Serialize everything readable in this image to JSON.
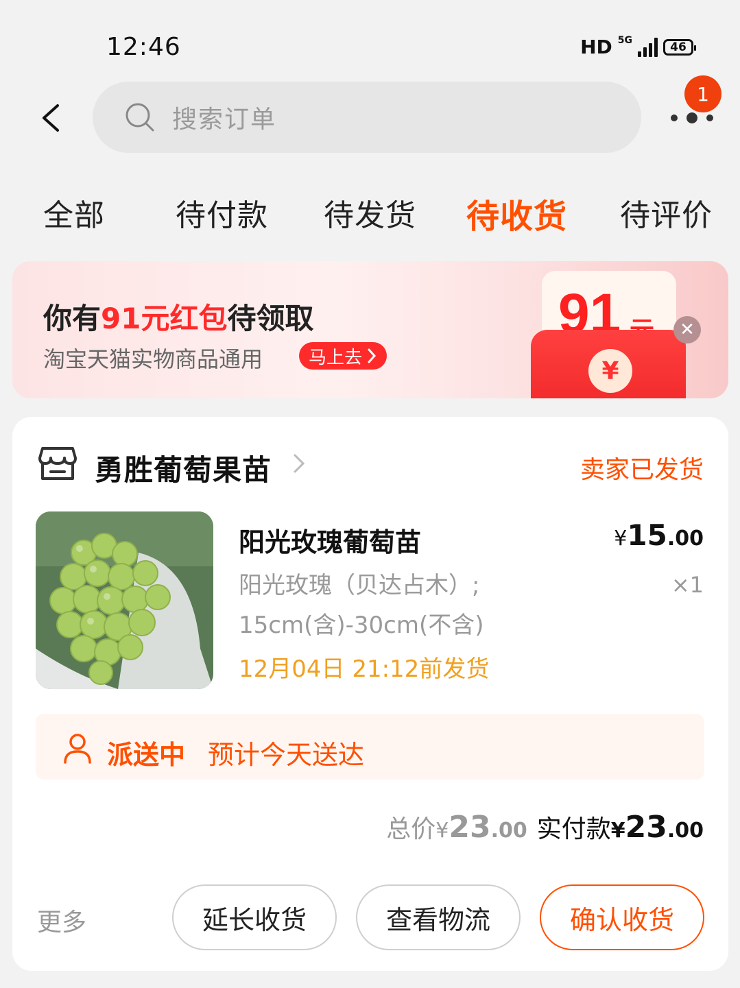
{
  "status_bar": {
    "time": "12:46",
    "network": "HD",
    "signal_type": "5G",
    "battery": "46"
  },
  "header": {
    "search_placeholder": "搜索订单",
    "notification_count": "1"
  },
  "tabs": [
    {
      "label": "全部",
      "active": false
    },
    {
      "label": "待付款",
      "active": false
    },
    {
      "label": "待发货",
      "active": false
    },
    {
      "label": "待收货",
      "active": true
    },
    {
      "label": "待评价",
      "active": false
    }
  ],
  "banner": {
    "title_prefix": "你有",
    "title_highlight": "91元红包",
    "title_suffix": "待领取",
    "subtitle": "淘宝天猫实物商品通用",
    "cta": "马上去",
    "amount": "91",
    "unit": "元",
    "coin": "¥"
  },
  "order": {
    "shop_name": "勇胜葡萄果苗",
    "status": "卖家已发货",
    "product": {
      "title": "阳光玫瑰葡萄苗",
      "sku_line1": "阳光玫瑰（贝达占木）;",
      "sku_line2": "15cm(含)-30cm(不含)",
      "ship_by": "12月04日 21:12前发货",
      "price_currency": "¥",
      "price_int": "15",
      "price_dec": ".00",
      "quantity": "×1"
    },
    "delivery": {
      "status": "派送中",
      "eta": "预计今天送达"
    },
    "totals": {
      "total_label": "总价",
      "total_currency": "¥",
      "total_int": "23",
      "total_dec": ".00",
      "paid_label": "实付款",
      "paid_currency": "¥",
      "paid_int": "23",
      "paid_dec": ".00"
    },
    "actions": {
      "more": "更多",
      "extend": "延长收货",
      "logistics": "查看物流",
      "confirm": "确认收货"
    }
  },
  "colors": {
    "accent": "#ff5000",
    "banner_red": "#ff2a2a",
    "ship_by": "#f0a020"
  }
}
